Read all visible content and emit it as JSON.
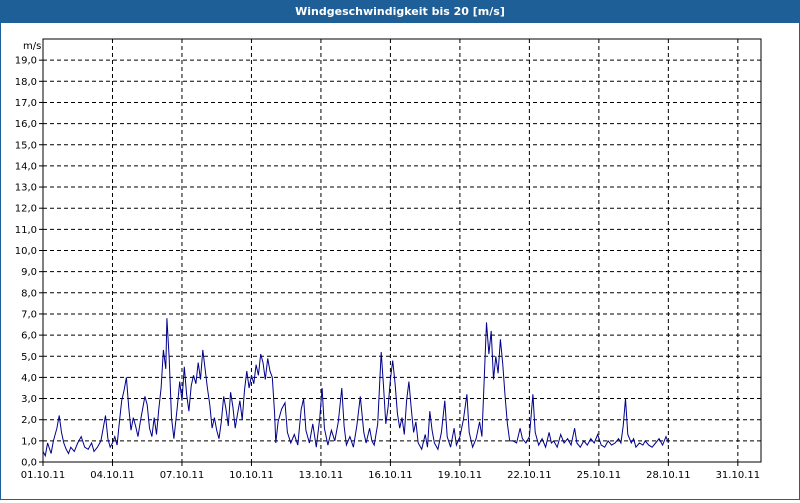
{
  "window": {
    "title": "Windgeschwindigkeit bis 20 [m/s]"
  },
  "colors": {
    "titlebar": "#1f5f97",
    "series": "#00008b",
    "grid": "#000000"
  },
  "chart_data": {
    "type": "line",
    "title": "Windgeschwindigkeit bis 20 [m/s]",
    "ylabel": "m/s",
    "xlabel": "",
    "ylim": [
      0,
      20
    ],
    "xlim": [
      "01.10.11",
      "01.11.11"
    ],
    "grid": true,
    "y_ticks": [
      "0,0",
      "1,0",
      "2,0",
      "3,0",
      "4,0",
      "5,0",
      "6,0",
      "7,0",
      "8,0",
      "9,0",
      "10,0",
      "11,0",
      "12,0",
      "13,0",
      "14,0",
      "15,0",
      "16,0",
      "17,0",
      "18,0",
      "19,0"
    ],
    "x_ticks": [
      "01.10.11",
      "04.10.11",
      "07.10.11",
      "10.10.11",
      "13.10.11",
      "16.10.11",
      "19.10.11",
      "22.10.11",
      "25.10.11",
      "28.10.11",
      "31.10.11"
    ],
    "series": [
      {
        "points": [
          [
            0,
            0.5
          ],
          [
            0.1,
            0.3
          ],
          [
            0.2,
            0.9
          ],
          [
            0.35,
            0.4
          ],
          [
            0.45,
            1.0
          ],
          [
            0.6,
            1.6
          ],
          [
            0.7,
            2.2
          ],
          [
            0.8,
            1.4
          ],
          [
            0.9,
            0.9
          ],
          [
            1.0,
            0.6
          ],
          [
            1.1,
            0.4
          ],
          [
            1.2,
            0.7
          ],
          [
            1.35,
            0.5
          ],
          [
            1.5,
            0.9
          ],
          [
            1.65,
            1.2
          ],
          [
            1.8,
            0.7
          ],
          [
            1.95,
            0.6
          ],
          [
            2.1,
            0.9
          ],
          [
            2.2,
            0.5
          ],
          [
            2.35,
            0.7
          ],
          [
            2.5,
            1.0
          ],
          [
            2.6,
            1.6
          ],
          [
            2.7,
            2.2
          ],
          [
            2.8,
            1.1
          ],
          [
            2.9,
            0.7
          ],
          [
            3.0,
            0.9
          ],
          [
            3.1,
            1.2
          ],
          [
            3.2,
            0.8
          ],
          [
            3.3,
            1.9
          ],
          [
            3.4,
            2.9
          ],
          [
            3.5,
            3.4
          ],
          [
            3.6,
            4.0
          ],
          [
            3.7,
            2.6
          ],
          [
            3.8,
            1.5
          ],
          [
            3.9,
            2.1
          ],
          [
            4.0,
            1.7
          ],
          [
            4.1,
            1.2
          ],
          [
            4.2,
            1.9
          ],
          [
            4.3,
            2.5
          ],
          [
            4.4,
            3.1
          ],
          [
            4.5,
            2.7
          ],
          [
            4.6,
            1.6
          ],
          [
            4.7,
            1.2
          ],
          [
            4.8,
            2.1
          ],
          [
            4.9,
            1.3
          ],
          [
            5.0,
            2.5
          ],
          [
            5.1,
            3.5
          ],
          [
            5.2,
            5.3
          ],
          [
            5.3,
            4.4
          ],
          [
            5.35,
            6.8
          ],
          [
            5.45,
            4.9
          ],
          [
            5.55,
            2.1
          ],
          [
            5.65,
            1.1
          ],
          [
            5.8,
            2.6
          ],
          [
            5.9,
            3.8
          ],
          [
            6.0,
            2.9
          ],
          [
            6.1,
            4.5
          ],
          [
            6.2,
            3.2
          ],
          [
            6.3,
            2.4
          ],
          [
            6.4,
            3.6
          ],
          [
            6.5,
            4.1
          ],
          [
            6.6,
            3.7
          ],
          [
            6.7,
            4.7
          ],
          [
            6.8,
            3.9
          ],
          [
            6.9,
            5.3
          ],
          [
            7.0,
            4.4
          ],
          [
            7.1,
            3.5
          ],
          [
            7.2,
            2.7
          ],
          [
            7.3,
            1.6
          ],
          [
            7.4,
            2.1
          ],
          [
            7.5,
            1.5
          ],
          [
            7.6,
            1.1
          ],
          [
            7.7,
            1.9
          ],
          [
            7.8,
            3.1
          ],
          [
            7.9,
            2.5
          ],
          [
            8.0,
            1.7
          ],
          [
            8.1,
            3.3
          ],
          [
            8.2,
            2.6
          ],
          [
            8.3,
            1.6
          ],
          [
            8.4,
            2.3
          ],
          [
            8.5,
            2.9
          ],
          [
            8.6,
            2.0
          ],
          [
            8.7,
            3.4
          ],
          [
            8.8,
            4.3
          ],
          [
            8.9,
            3.5
          ],
          [
            9.0,
            4.1
          ],
          [
            9.1,
            3.7
          ],
          [
            9.2,
            4.6
          ],
          [
            9.3,
            4.1
          ],
          [
            9.4,
            5.1
          ],
          [
            9.5,
            4.7
          ],
          [
            9.6,
            3.9
          ],
          [
            9.7,
            4.9
          ],
          [
            9.8,
            4.3
          ],
          [
            9.9,
            4.0
          ],
          [
            10.0,
            2.3
          ],
          [
            10.05,
            0.9
          ],
          [
            10.15,
            1.9
          ],
          [
            10.3,
            2.5
          ],
          [
            10.45,
            2.8
          ],
          [
            10.55,
            1.4
          ],
          [
            10.7,
            0.9
          ],
          [
            10.85,
            1.3
          ],
          [
            11.0,
            0.8
          ],
          [
            11.15,
            2.5
          ],
          [
            11.25,
            3.0
          ],
          [
            11.35,
            1.5
          ],
          [
            11.5,
            0.9
          ],
          [
            11.65,
            1.8
          ],
          [
            11.8,
            0.7
          ],
          [
            11.95,
            2.1
          ],
          [
            12.05,
            3.5
          ],
          [
            12.15,
            1.6
          ],
          [
            12.3,
            0.8
          ],
          [
            12.45,
            1.5
          ],
          [
            12.6,
            1.0
          ],
          [
            12.75,
            1.9
          ],
          [
            12.9,
            3.5
          ],
          [
            13.0,
            1.7
          ],
          [
            13.1,
            0.8
          ],
          [
            13.25,
            1.2
          ],
          [
            13.4,
            0.7
          ],
          [
            13.55,
            1.7
          ],
          [
            13.7,
            3.1
          ],
          [
            13.85,
            1.4
          ],
          [
            13.95,
            0.9
          ],
          [
            14.1,
            1.6
          ],
          [
            14.2,
            1.0
          ],
          [
            14.3,
            0.8
          ],
          [
            14.45,
            1.8
          ],
          [
            14.6,
            5.2
          ],
          [
            14.7,
            3.6
          ],
          [
            14.8,
            1.8
          ],
          [
            14.9,
            2.6
          ],
          [
            15.0,
            3.9
          ],
          [
            15.1,
            4.8
          ],
          [
            15.2,
            3.7
          ],
          [
            15.3,
            2.3
          ],
          [
            15.4,
            1.6
          ],
          [
            15.5,
            2.1
          ],
          [
            15.6,
            1.3
          ],
          [
            15.7,
            2.9
          ],
          [
            15.8,
            3.8
          ],
          [
            15.9,
            2.5
          ],
          [
            16.0,
            1.4
          ],
          [
            16.1,
            1.9
          ],
          [
            16.2,
            0.9
          ],
          [
            16.35,
            0.6
          ],
          [
            16.5,
            1.3
          ],
          [
            16.6,
            0.7
          ],
          [
            16.7,
            2.4
          ],
          [
            16.8,
            1.5
          ],
          [
            16.9,
            0.9
          ],
          [
            17.05,
            0.6
          ],
          [
            17.2,
            1.4
          ],
          [
            17.35,
            2.9
          ],
          [
            17.45,
            1.2
          ],
          [
            17.6,
            0.7
          ],
          [
            17.75,
            1.6
          ],
          [
            17.85,
            0.8
          ],
          [
            18.0,
            1.2
          ],
          [
            18.15,
            2.0
          ],
          [
            18.3,
            3.2
          ],
          [
            18.4,
            1.4
          ],
          [
            18.55,
            0.7
          ],
          [
            18.7,
            1.1
          ],
          [
            18.85,
            1.9
          ],
          [
            18.95,
            1.2
          ],
          [
            19.05,
            3.9
          ],
          [
            19.15,
            6.6
          ],
          [
            19.25,
            5.1
          ],
          [
            19.35,
            6.2
          ],
          [
            19.45,
            3.9
          ],
          [
            19.55,
            5.0
          ],
          [
            19.65,
            4.2
          ],
          [
            19.75,
            5.8
          ],
          [
            19.85,
            4.6
          ],
          [
            19.95,
            3.1
          ],
          [
            20.05,
            1.8
          ],
          [
            20.15,
            1.0
          ],
          [
            20.3,
            1.0
          ],
          [
            20.45,
            0.9
          ],
          [
            20.6,
            1.6
          ],
          [
            20.7,
            1.1
          ],
          [
            20.85,
            0.9
          ],
          [
            21.0,
            1.2
          ],
          [
            21.15,
            3.2
          ],
          [
            21.25,
            1.4
          ],
          [
            21.4,
            0.8
          ],
          [
            21.55,
            1.1
          ],
          [
            21.7,
            0.7
          ],
          [
            21.85,
            1.4
          ],
          [
            21.95,
            0.9
          ],
          [
            22.05,
            1.0
          ],
          [
            22.2,
            0.7
          ],
          [
            22.35,
            1.3
          ],
          [
            22.5,
            0.9
          ],
          [
            22.65,
            1.1
          ],
          [
            22.8,
            0.8
          ],
          [
            22.95,
            1.6
          ],
          [
            23.05,
            0.9
          ],
          [
            23.2,
            0.7
          ],
          [
            23.35,
            1.0
          ],
          [
            23.5,
            0.8
          ],
          [
            23.65,
            1.1
          ],
          [
            23.8,
            0.9
          ],
          [
            23.95,
            1.3
          ],
          [
            24.1,
            0.8
          ],
          [
            24.25,
            0.7
          ],
          [
            24.4,
            1.0
          ],
          [
            24.55,
            0.8
          ],
          [
            24.7,
            0.9
          ],
          [
            24.85,
            1.1
          ],
          [
            24.95,
            0.9
          ],
          [
            25.05,
            1.7
          ],
          [
            25.15,
            3.0
          ],
          [
            25.25,
            1.3
          ],
          [
            25.4,
            0.9
          ],
          [
            25.5,
            1.1
          ],
          [
            25.6,
            0.7
          ],
          [
            25.75,
            0.9
          ],
          [
            25.9,
            0.8
          ],
          [
            26.0,
            1.0
          ],
          [
            26.15,
            0.8
          ],
          [
            26.3,
            0.7
          ],
          [
            26.45,
            0.9
          ],
          [
            26.6,
            1.1
          ],
          [
            26.75,
            0.8
          ],
          [
            26.9,
            1.2
          ],
          [
            27.0,
            0.9
          ]
        ]
      }
    ]
  }
}
